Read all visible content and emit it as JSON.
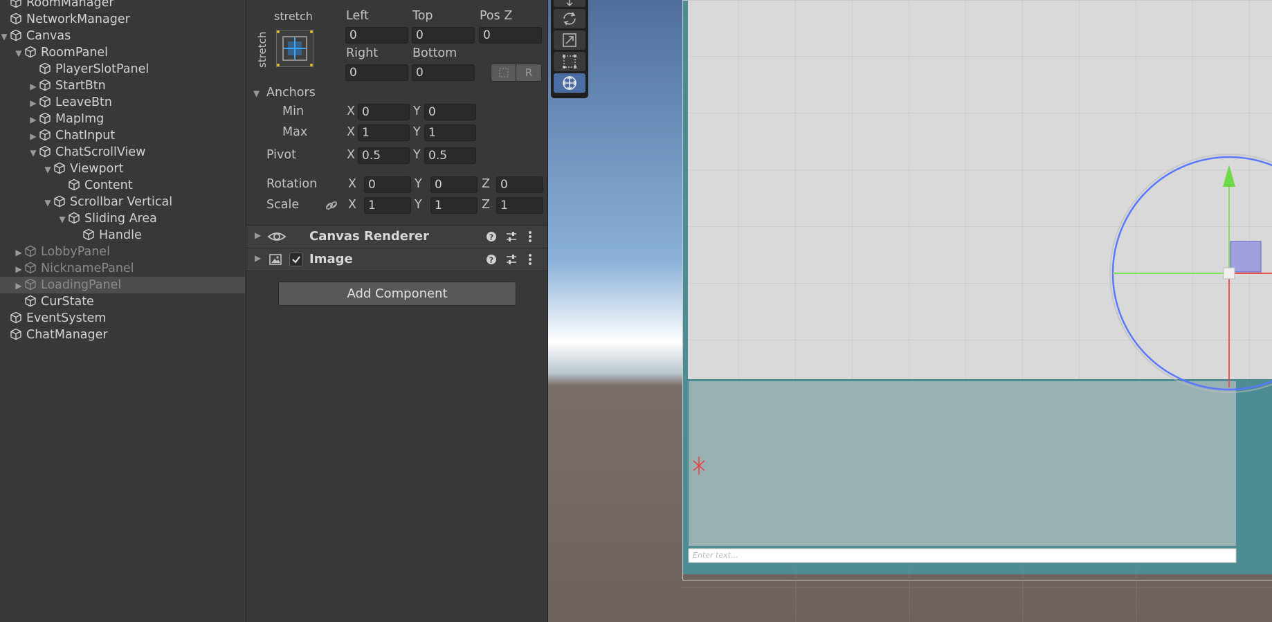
{
  "hierarchy": {
    "items": [
      {
        "label": "RoomManager",
        "depth": 0,
        "arrow": "",
        "dim": false
      },
      {
        "label": "NetworkManager",
        "depth": 0,
        "arrow": "",
        "dim": false
      },
      {
        "label": "Canvas",
        "depth": 0,
        "arrow": "open",
        "dim": false
      },
      {
        "label": "RoomPanel",
        "depth": 1,
        "arrow": "open",
        "dim": false
      },
      {
        "label": "PlayerSlotPanel",
        "depth": 2,
        "arrow": "",
        "dim": false
      },
      {
        "label": "StartBtn",
        "depth": 2,
        "arrow": "closed",
        "dim": false
      },
      {
        "label": "LeaveBtn",
        "depth": 2,
        "arrow": "closed",
        "dim": false
      },
      {
        "label": "MapImg",
        "depth": 2,
        "arrow": "closed",
        "dim": false
      },
      {
        "label": "ChatInput",
        "depth": 2,
        "arrow": "closed",
        "dim": false
      },
      {
        "label": "ChatScrollView",
        "depth": 2,
        "arrow": "open",
        "dim": false
      },
      {
        "label": "Viewport",
        "depth": 3,
        "arrow": "open",
        "dim": false
      },
      {
        "label": "Content",
        "depth": 4,
        "arrow": "",
        "dim": false
      },
      {
        "label": "Scrollbar Vertical",
        "depth": 3,
        "arrow": "open",
        "dim": false
      },
      {
        "label": "Sliding Area",
        "depth": 4,
        "arrow": "open",
        "dim": false
      },
      {
        "label": "Handle",
        "depth": 5,
        "arrow": "",
        "dim": false
      },
      {
        "label": "LobbyPanel",
        "depth": 1,
        "arrow": "closed",
        "dim": true
      },
      {
        "label": "NicknamePanel",
        "depth": 1,
        "arrow": "closed",
        "dim": true
      },
      {
        "label": "LoadingPanel",
        "depth": 1,
        "arrow": "closed",
        "dim": true,
        "selected": true
      },
      {
        "label": "CurState",
        "depth": 1,
        "arrow": "",
        "dim": false
      },
      {
        "label": "EventSystem",
        "depth": 0,
        "arrow": "",
        "dim": false
      },
      {
        "label": "ChatManager",
        "depth": 0,
        "arrow": "",
        "dim": false
      }
    ]
  },
  "rect": {
    "anchor_top_label": "stretch",
    "anchor_side_label": "stretch",
    "left_label": "Left",
    "left": "0",
    "top_label": "Top",
    "top": "0",
    "posz_label": "Pos Z",
    "posz": "0",
    "right_label": "Right",
    "right": "0",
    "bottom_label": "Bottom",
    "bottom": "0",
    "r_btn": "R"
  },
  "anchors": {
    "header": "Anchors",
    "min_label": "Min",
    "min_x": "0",
    "min_y": "0",
    "max_label": "Max",
    "max_x": "1",
    "max_y": "1",
    "x": "X",
    "y": "Y",
    "z": "Z"
  },
  "pivot": {
    "label": "Pivot",
    "x": "0.5",
    "y": "0.5"
  },
  "rotation": {
    "label": "Rotation",
    "x": "0",
    "y": "0",
    "z": "0"
  },
  "scale": {
    "label": "Scale",
    "x": "1",
    "y": "1",
    "z": "1"
  },
  "components": {
    "canvas_renderer": "Canvas Renderer",
    "image": "Image",
    "add_component": "Add Component"
  },
  "scene": {
    "input_placeholder": "Enter text..."
  },
  "colors": {
    "panel": "#383838",
    "field": "#2a2a2a",
    "accent_blue": "#5a78ff",
    "gizmo_green": "#7ee05a",
    "gizmo_red": "#f05050"
  }
}
